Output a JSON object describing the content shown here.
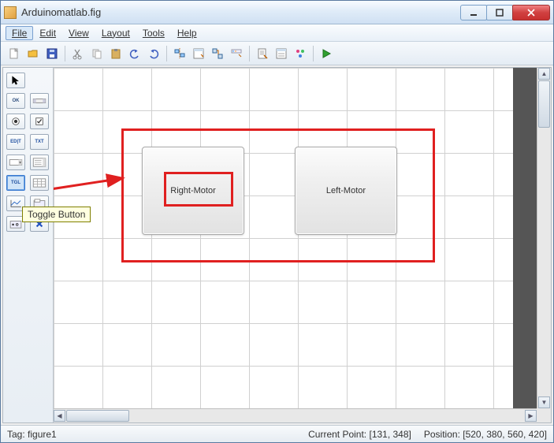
{
  "window": {
    "title": "Arduinomatlab.fig"
  },
  "menu": {
    "file": "File",
    "edit": "Edit",
    "view": "View",
    "layout": "Layout",
    "tools": "Tools",
    "help": "Help"
  },
  "tooltip": {
    "toggle_button": "Toggle Button"
  },
  "palette": {
    "cursor": "cursor",
    "pushbutton": "OK",
    "slider": "slider",
    "radio": "radio",
    "checkbox": "check",
    "edit": "EDIT",
    "text": "TXT",
    "popup": "popup",
    "listbox": "list",
    "toggle": "TGL",
    "table": "table",
    "axes": "axes",
    "panel": "panel",
    "buttongroup": "bgrp",
    "activex": "X"
  },
  "canvas": {
    "right_motor_label": "Right-Motor",
    "left_motor_label": "Left-Motor"
  },
  "status": {
    "tag_label": "Tag: ",
    "tag_value": "figure1",
    "current_point_label": "Current Point:   ",
    "current_point_value": "[131, 348]",
    "position_label": "Position: ",
    "position_value": "[520, 380, 560, 420]"
  },
  "colors": {
    "annotation_red": "#e02020"
  }
}
